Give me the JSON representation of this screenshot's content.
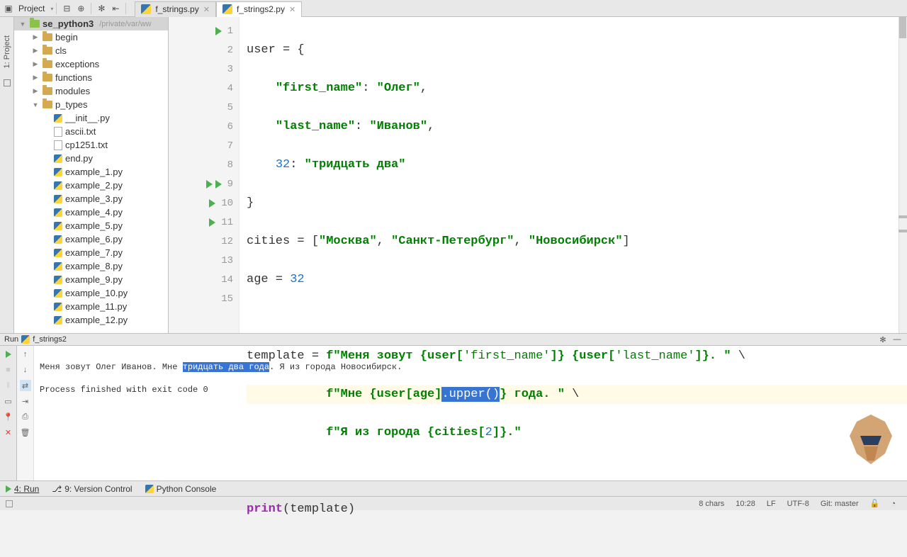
{
  "toolbar": {
    "project_label": "Project"
  },
  "tabs": [
    {
      "name": "f_strings.py",
      "active": false
    },
    {
      "name": "f_strings2.py",
      "active": true
    }
  ],
  "sidebar_rail": {
    "label": "1: Project"
  },
  "project_tree": {
    "root": {
      "name": "se_python3",
      "path": "/private/var/ww"
    },
    "folders": [
      "begin",
      "cls",
      "exceptions",
      "functions",
      "modules",
      "p_types"
    ],
    "p_types_files": [
      "__init__.py",
      "ascii.txt",
      "cp1251.txt",
      "end.py",
      "example_1.py",
      "example_2.py",
      "example_3.py",
      "example_4.py",
      "example_5.py",
      "example_6.py",
      "example_7.py",
      "example_8.py",
      "example_9.py",
      "example_10.py",
      "example_11.py",
      "example_12.py"
    ]
  },
  "editor": {
    "lines": {
      "1": "user = {",
      "2_key": "\"first_name\"",
      "2_val": "\"Олег\"",
      "3_key": "\"last_name\"",
      "3_val": "\"Иванов\"",
      "4_key": "32",
      "4_val": "\"тридцать два\"",
      "5": "}",
      "6_a": "cities = [",
      "6_b": "\"Москва\"",
      "6_c": "\"Санкт-Петербург\"",
      "6_d": "\"Новосибирск\"",
      "6_e": "]",
      "7_a": "age = ",
      "7_b": "32",
      "9_a": "template = ",
      "9_b": "f\"Меня зовут ",
      "9_c": "{user[",
      "9_d": "'first_name'",
      "9_e": "]} {user[",
      "9_f": "'last_name'",
      "9_g": "]}. \"",
      "9_h": " \\",
      "10_a": "f\"Мне ",
      "10_b": "{user[age]",
      "10_sel": ".upper()",
      "10_c": "} года. \"",
      "10_d": " \\",
      "11_a": "f\"Я из города ",
      "11_b": "{cities[",
      "11_c": "2",
      "11_d": "]}.\"",
      "13": "print(template)"
    },
    "line_numbers": [
      "1",
      "2",
      "3",
      "4",
      "5",
      "6",
      "7",
      "8",
      "9",
      "10",
      "11",
      "12",
      "13",
      "14",
      "15"
    ]
  },
  "run": {
    "label": "Run",
    "config_name": "f_strings2",
    "output_line": "Меня зовут Олег Иванов. Мне ",
    "output_sel": "тридцать два года",
    "output_after": ". Я из города Новосибирск.",
    "exit_msg": "Process finished with exit code 0"
  },
  "bottom_tools": {
    "run": "4: Run",
    "vcs": "9: Version Control",
    "console": "Python Console"
  },
  "status": {
    "chars": "8 chars",
    "pos": "10:28",
    "line_sep": "LF",
    "encoding": "UTF-8",
    "git": "Git: master"
  }
}
